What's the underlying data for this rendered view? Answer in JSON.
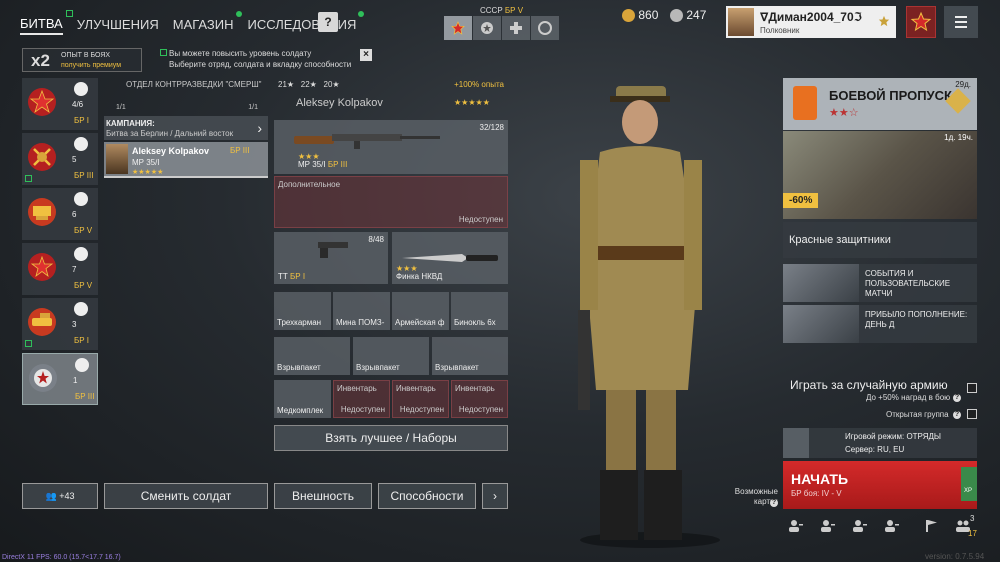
{
  "nav": {
    "tabs": [
      {
        "label": "БИТВА"
      },
      {
        "label": "УЛУЧШЕНИЯ"
      },
      {
        "label": "МАГАЗИН"
      },
      {
        "label": "ИССЛЕДОВАНИЯ"
      }
    ],
    "help": "?"
  },
  "nation": {
    "name": "СССР",
    "br": "БР V"
  },
  "currency": {
    "gold": "860",
    "silver": "247"
  },
  "profile": {
    "name": "∇Диман2004_70ℑ",
    "rank": "Полковник"
  },
  "boost": {
    "mult": "x2",
    "label": "ОПЫТ В БОЯХ",
    "action": "получить премиум"
  },
  "hint": {
    "line1": "Вы можете повысить уровень солдату",
    "line2": "Выберите отряд, солдата и вкладку способности"
  },
  "squads": [
    {
      "count": "4/6",
      "br": "БР I"
    },
    {
      "count": "5",
      "br": "БР III"
    },
    {
      "count": "6",
      "br": "БР V"
    },
    {
      "count": "7",
      "br": "БР V"
    },
    {
      "count": "3",
      "br": "БР I"
    },
    {
      "count": "1",
      "br": "БР III"
    }
  ],
  "squad_info": {
    "title": "ОТДЕЛ КОНТРРАЗВЕДКИ \"СМЕРШ\"",
    "count1": "1/1",
    "count2": "1/1"
  },
  "campaign": {
    "label": "КАМПАНИЯ:",
    "name": "Битва за Берлин / Дальний восток"
  },
  "soldier": {
    "name": "Aleksey Kolpakov",
    "weapon": "МР 35/I",
    "br": "БР III",
    "stars": "★★★★★"
  },
  "loadout": {
    "stats": {
      "a": "21",
      "b": "22",
      "c": "20",
      "xp": "+100% опыта"
    },
    "name": "Aleksey Kolpakov",
    "stars": "★★★★★",
    "primary": {
      "name": "МР 35/I",
      "br": "БР III",
      "ammo": "32/128",
      "stars": "★★★"
    },
    "extra": {
      "label": "Дополнительное",
      "na": "Недоступен"
    },
    "pistol": {
      "name": "ТТ",
      "br": "БР I",
      "ammo": "8/48"
    },
    "melee": {
      "name": "Финка НКВД",
      "stars": "★★★"
    },
    "items": [
      "Трехкарман",
      "Мина ПОМЗ-",
      "Армейская ф",
      "Бинокль 6х"
    ],
    "explosives": [
      "Взрывпакет",
      "Взрывпакет",
      "Взрывпакет"
    ],
    "inv": {
      "medkit": "Медкомплек",
      "slot": "Инвентарь",
      "na": "Недоступен"
    },
    "best": "Взять лучшее / Наборы"
  },
  "bottom": {
    "group": "+43",
    "change": "Сменить солдат",
    "look": "Внешность",
    "abilities": "Способности",
    "next": "›"
  },
  "battlepass": {
    "title": "БОЕВОЙ ПРОПУСК",
    "stars": "★★☆",
    "days": "29д."
  },
  "offer": {
    "timer": "1д. 19ч.",
    "discount": "-60%",
    "name": "Красные защитники"
  },
  "events": [
    {
      "text": "СОБЫТИЯ И ПОЛЬЗОВАТЕЛЬСКИЕ МАТЧИ"
    },
    {
      "text": "ПРИБЫЛО ПОПОЛНЕНИЕ: ДЕНЬ Д"
    }
  ],
  "random": {
    "label": "Играть за случайную армию",
    "sub": "До +50% наград в бою",
    "group": "Открытая группа"
  },
  "mode": {
    "line1": "Игровой режим: ОТРЯДЫ",
    "line2": "Сервер: RU, EU"
  },
  "start": {
    "label": "НАЧАТЬ",
    "br": "БР боя: IV - V",
    "xp": "XP"
  },
  "maps": "Возможные карты:",
  "party": {
    "count": "3",
    "online": "17"
  },
  "footer": {
    "fps": "DirectX 11 FPS: 60.0 (15.7<17.7 16.7)",
    "version": "version: 0.7.5.94"
  },
  "colors": {
    "accent": "#f0c040",
    "start": "#d42a2a",
    "green": "#2fbf5a"
  }
}
